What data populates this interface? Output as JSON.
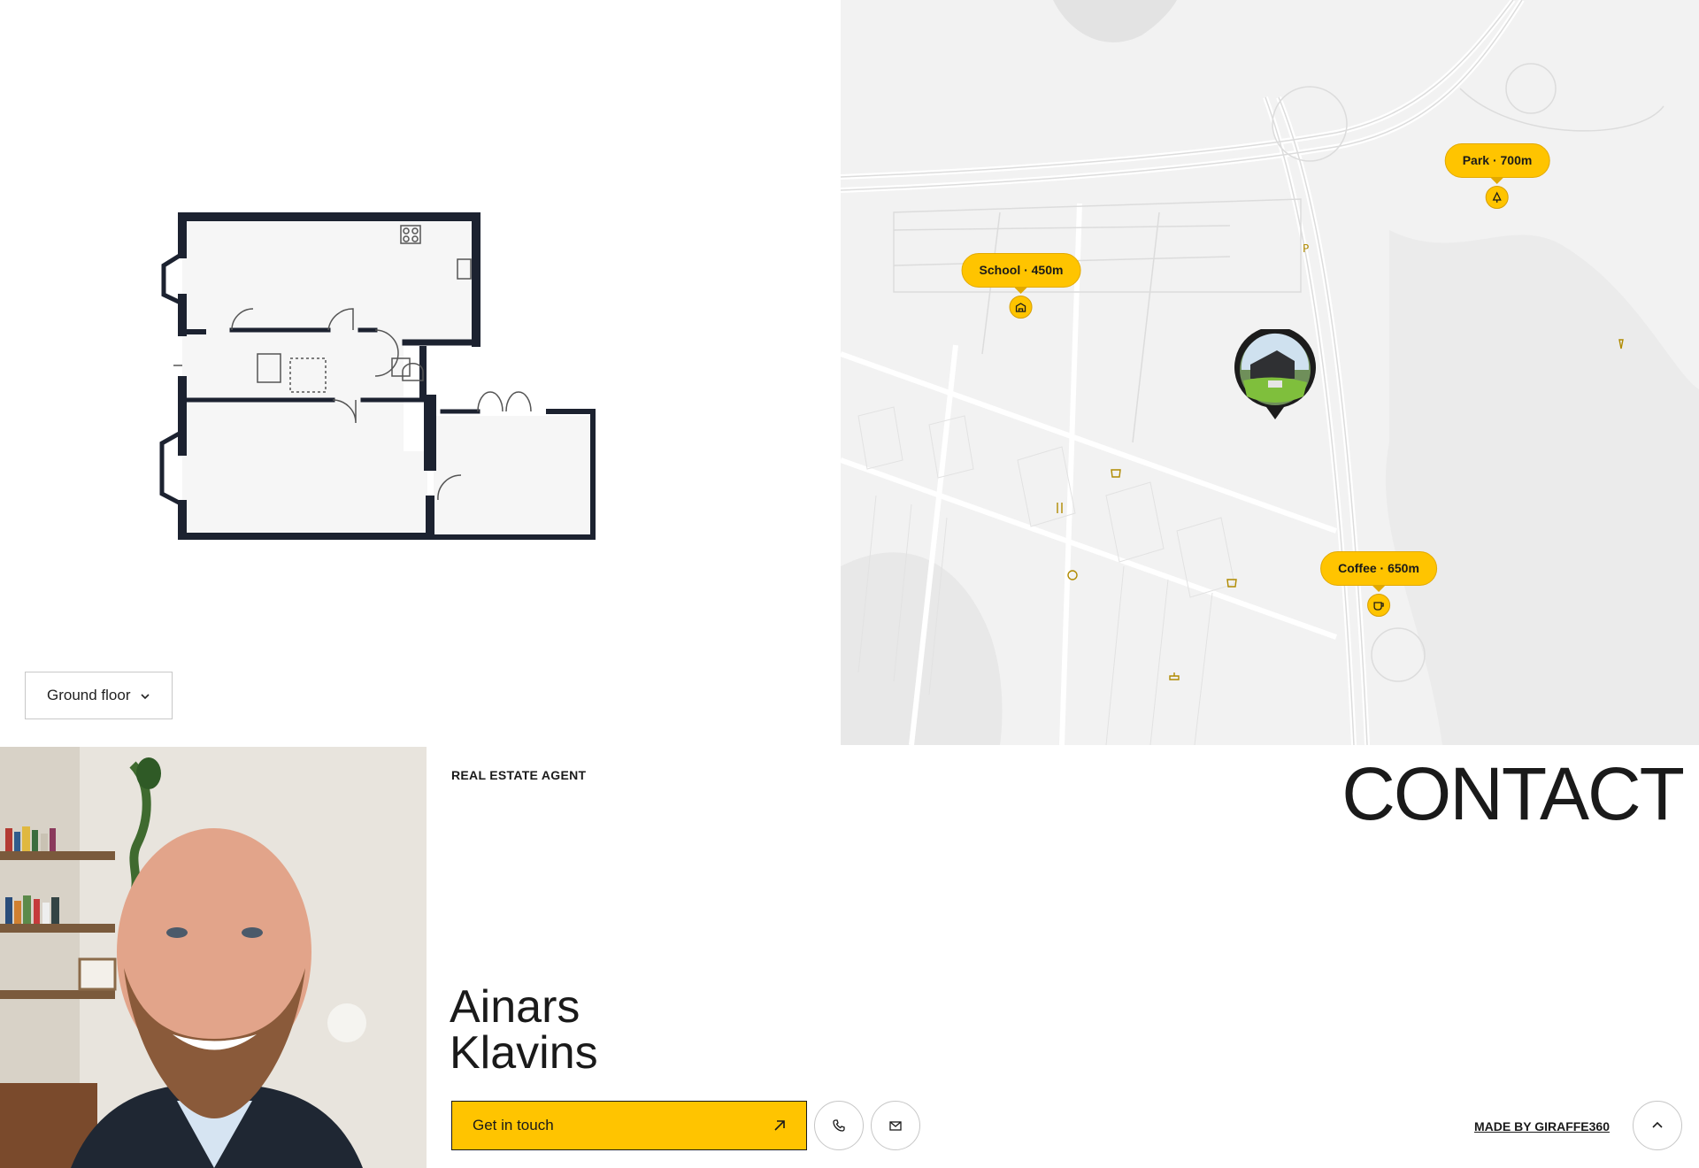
{
  "floorplan": {
    "floor_selector": {
      "value": "Ground floor"
    }
  },
  "map": {
    "pois": [
      {
        "label": "School · 450m",
        "icon": "school-icon"
      },
      {
        "label": "Park · 700m",
        "icon": "tree-icon"
      },
      {
        "label": "Coffee · 650m",
        "icon": "coffee-icon"
      }
    ],
    "accent_color": "#ffc400"
  },
  "agent": {
    "role": "REAL ESTATE AGENT",
    "first_name": "Ainars",
    "last_name": "Klavins"
  },
  "contact": {
    "heading": "CONTACT",
    "get_in_touch_label": "Get in touch",
    "phone_icon": "phone-icon",
    "email_icon": "mail-icon"
  },
  "footer": {
    "made_by": "MADE BY GIRAFFE360",
    "scroll_top_icon": "chevron-up-icon"
  }
}
